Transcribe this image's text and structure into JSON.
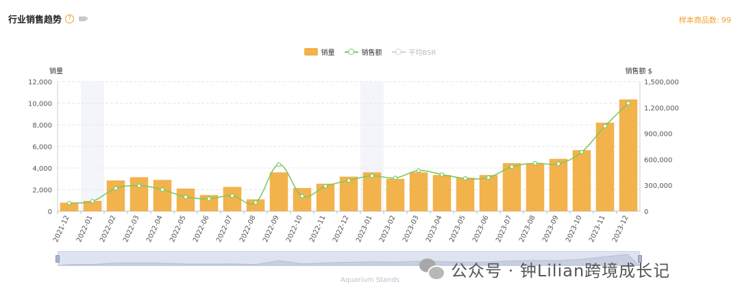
{
  "header": {
    "title": "行业销售趋势",
    "help_glyph": "?",
    "sample_label": "样本商品数: 99"
  },
  "legend": [
    {
      "name": "销量",
      "kind": "bar",
      "color": "#f2b24c",
      "active": true
    },
    {
      "name": "销售额",
      "kind": "line",
      "color": "#7ec860",
      "active": true
    },
    {
      "name": "平均BSR",
      "kind": "line",
      "color": "#cccccc",
      "active": false
    }
  ],
  "slider": {
    "caption": "Aquarium Stands"
  },
  "watermark": {
    "text": "公众号 · 钟Lilian跨境成长记",
    "icon": "wechat-icon"
  },
  "chart_data": {
    "type": "bar",
    "categories": [
      "2021-12",
      "2022-01",
      "2022-02",
      "2022-03",
      "2022-04",
      "2022-05",
      "2022-06",
      "2022-07",
      "2022-08",
      "2022-09",
      "2022-10",
      "2022-11",
      "2022-12",
      "2023-01",
      "2023-02",
      "2023-03",
      "2023-04",
      "2023-05",
      "2023-06",
      "2023-07",
      "2023-08",
      "2023-09",
      "2023-10",
      "2023-11",
      "2023-12"
    ],
    "series": [
      {
        "name": "销量",
        "type": "bar",
        "axis": "left",
        "color": "#f2b24c",
        "values": [
          800,
          950,
          2850,
          3150,
          2900,
          2100,
          1500,
          2250,
          1100,
          3600,
          2150,
          2550,
          3200,
          3600,
          3000,
          3600,
          3350,
          3100,
          3350,
          4450,
          4450,
          4850,
          5650,
          8200,
          10350
        ]
      },
      {
        "name": "销售额",
        "type": "line",
        "axis": "right",
        "color": "#7ec860",
        "values": [
          95000,
          115000,
          265000,
          295000,
          250000,
          165000,
          145000,
          180000,
          100000,
          540000,
          175000,
          290000,
          355000,
          410000,
          385000,
          470000,
          425000,
          380000,
          390000,
          515000,
          555000,
          550000,
          685000,
          985000,
          1250000
        ]
      }
    ],
    "y_left": {
      "name": "销量",
      "min": 0,
      "max": 12000,
      "ticks": [
        "0",
        "2,000",
        "4,000",
        "6,000",
        "8,000",
        "10,000",
        "12,000"
      ]
    },
    "y_right": {
      "name": "销售额 $",
      "min": 0,
      "max": 1500000,
      "ticks": [
        "0",
        "300,000",
        "600,000",
        "900,000",
        "1,200,000",
        "1,500,000"
      ]
    },
    "highlight_categories": [
      "2022-01",
      "2023-01"
    ],
    "grid": true,
    "legend_position": "top-center"
  }
}
